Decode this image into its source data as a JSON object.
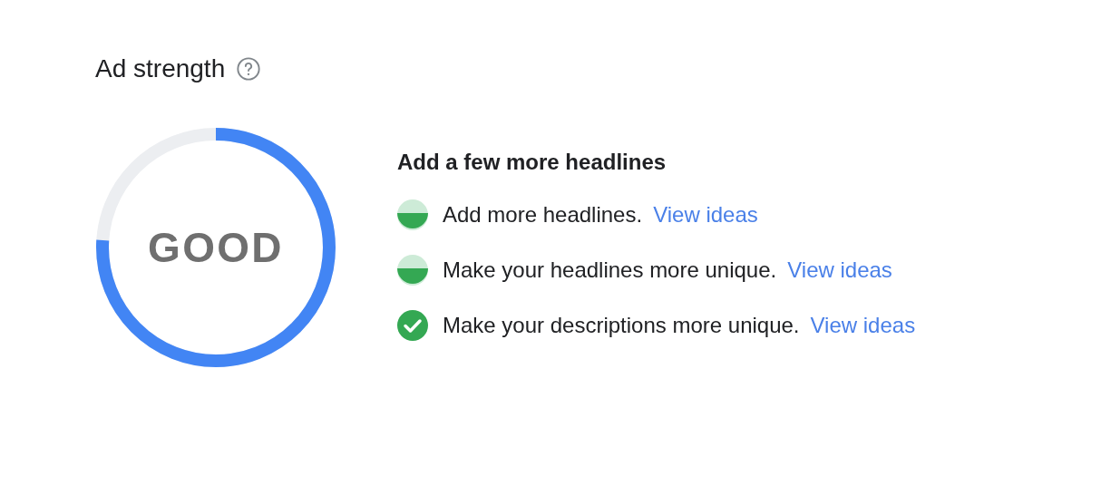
{
  "title": "Ad strength",
  "gauge": {
    "label": "GOOD",
    "level": 0.76
  },
  "suggestions": {
    "heading": "Add a few more headlines",
    "items": [
      {
        "kind": "partial",
        "text": "Add more headlines.",
        "link": "View ideas"
      },
      {
        "kind": "partial",
        "text": "Make your headlines more unique.",
        "link": "View ideas"
      },
      {
        "kind": "done",
        "text": "Make your descriptions more unique.",
        "link": "View ideas"
      }
    ]
  }
}
